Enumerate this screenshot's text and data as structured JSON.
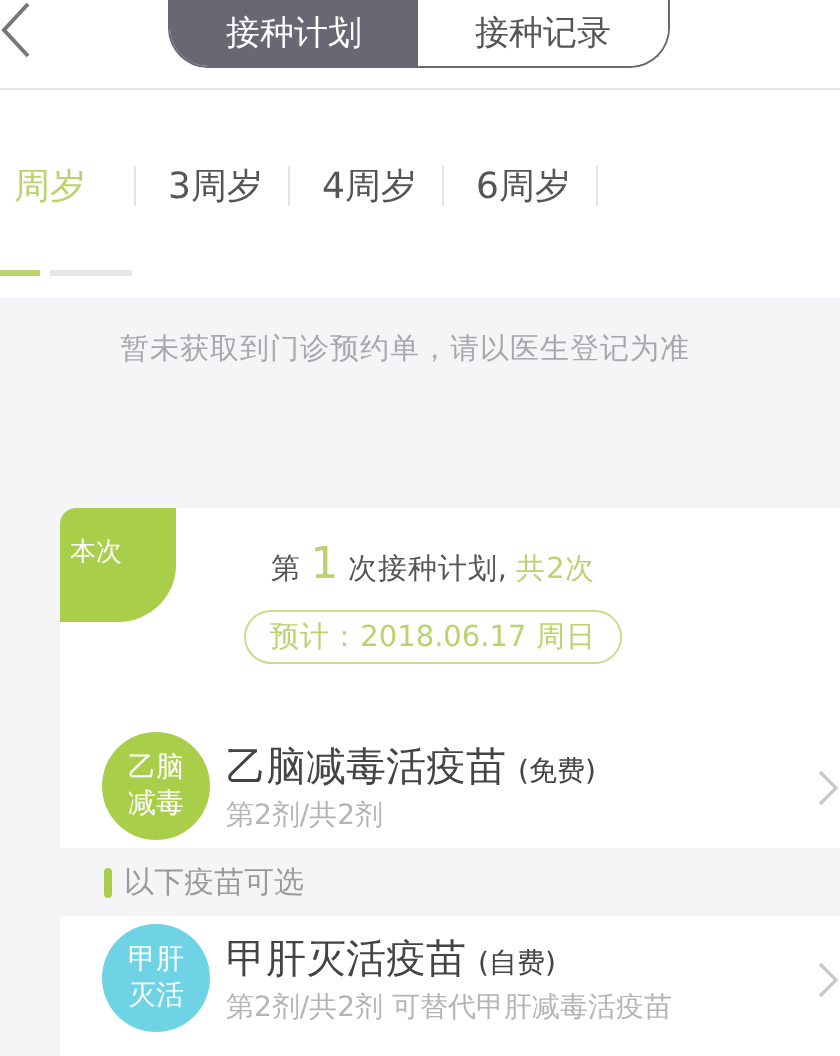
{
  "segments": [
    {
      "label": "接种计划",
      "selected": true
    },
    {
      "label": "接种记录",
      "selected": false
    }
  ],
  "age_tabs": [
    {
      "label": "周岁",
      "selected": true
    },
    {
      "label": "3周岁",
      "selected": false
    },
    {
      "label": "4周岁",
      "selected": false
    },
    {
      "label": "6周岁",
      "selected": false
    }
  ],
  "notice": "暂未获取到门诊预约单，请以医生登记为准",
  "plan": {
    "badge": "本次",
    "prefix": "第",
    "number": "1",
    "middle": "次接种计划,",
    "total": "共2次",
    "date": "预计：2018.06.17 周日"
  },
  "items": [
    {
      "kind": "vaccine",
      "badge_lines": [
        "乙脑",
        "减毒"
      ],
      "color": "#a9cf4a",
      "name": "乙脑减毒活疫苗",
      "fee": "(免费)",
      "dose": "第2剂/共2剂"
    },
    {
      "kind": "section",
      "label": "以下疫苗可选"
    },
    {
      "kind": "vaccine",
      "badge_lines": [
        "甲肝",
        "灭活"
      ],
      "color": "#6fd3e6",
      "name": "甲肝灭活疫苗",
      "fee": "(自费)",
      "dose": "第2剂/共2剂 可替代甲肝减毒活疫苗"
    }
  ]
}
